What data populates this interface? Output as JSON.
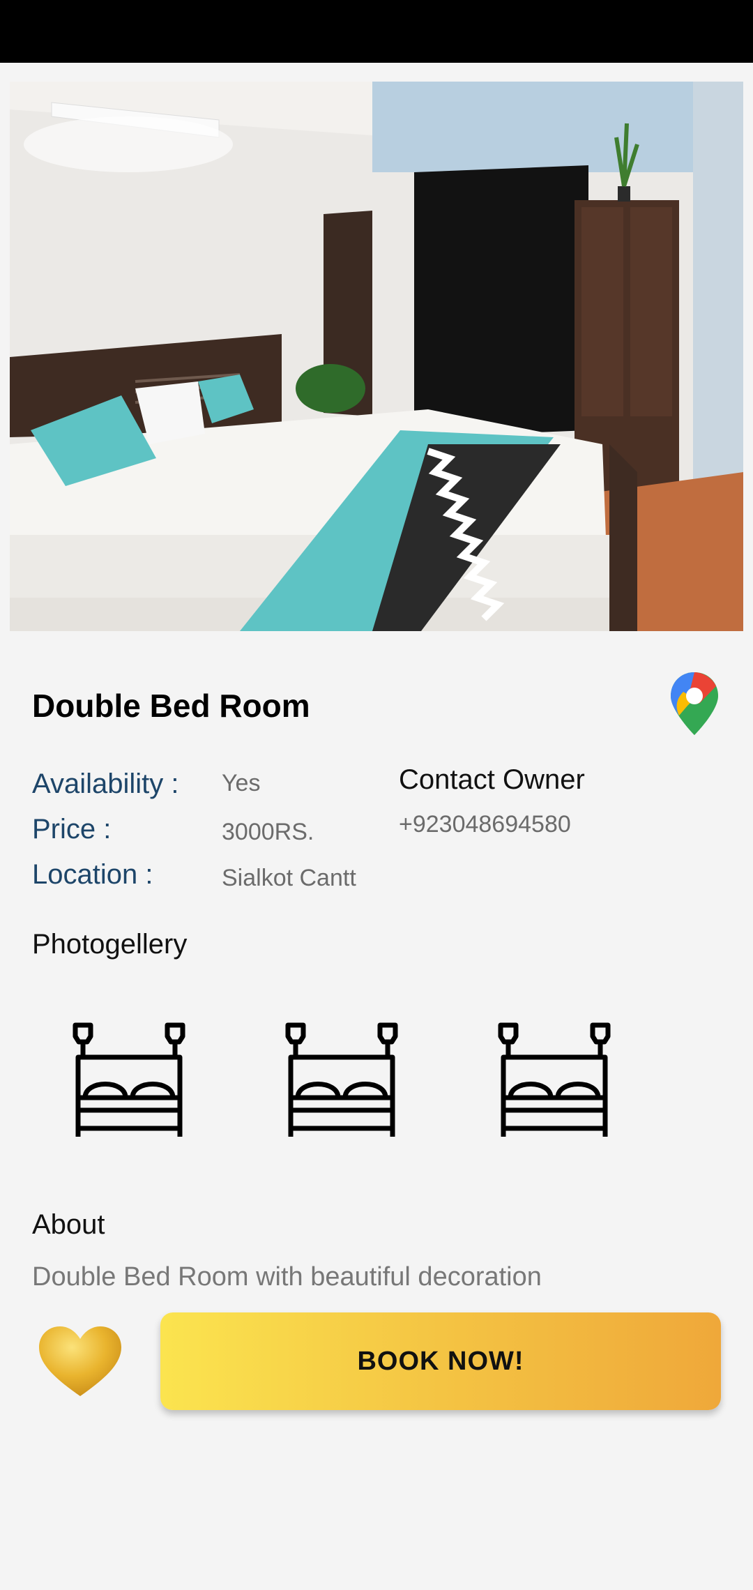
{
  "room": {
    "title": "Double Bed Room",
    "photo_icon": "room-photo",
    "map_icon": "google-maps-pin-icon"
  },
  "details": {
    "availability_label": "Availability :",
    "availability_value": "Yes",
    "price_label": "Price :",
    "price_value": "3000RS.",
    "location_label": "Location :",
    "location_value": "Sialkot Cantt"
  },
  "contact": {
    "title": "Contact Owner",
    "phone": "+923048694580"
  },
  "gallery": {
    "title": "Photogellery",
    "thumb_icon": "bed-icon",
    "count": 3
  },
  "about": {
    "title": "About",
    "text": "Double Bed Room with beautiful decoration"
  },
  "actions": {
    "favorite_icon": "heart-icon",
    "book_label": "BOOK NOW!"
  },
  "colors": {
    "label_blue": "#1d4569",
    "button_gradient_start": "#fbe44f",
    "button_gradient_end": "#efa83a",
    "heart_gold": "#e9b42e"
  }
}
